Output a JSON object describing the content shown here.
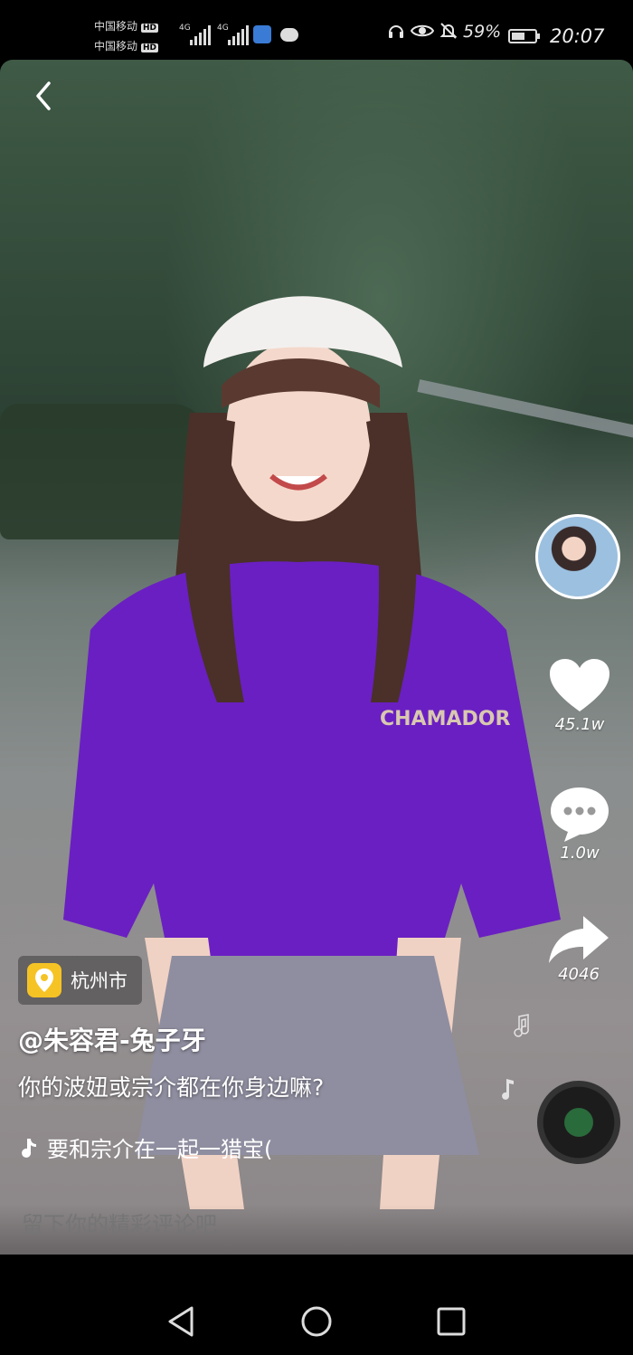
{
  "status_bar": {
    "carrier_1": "中国移动",
    "carrier_2": "中国移动",
    "hd_badge": "HD",
    "net_1": "4G",
    "net_2": "4G",
    "battery_percent": "59%",
    "battery_level": 0.59,
    "time": "20:07",
    "icons": [
      "headphones-icon",
      "eye-icon",
      "bell-off-icon",
      "battery-icon"
    ]
  },
  "video": {
    "back_icon": "chevron-left-icon",
    "like_count": "45.1w",
    "comment_count": "1.0w",
    "share_count": "4046",
    "location": "杭州市",
    "author": "@朱容君-兔子牙",
    "caption": "你的波妞或宗介都在你身边嘛?",
    "music": "要和宗介在一起一猎宝(",
    "comment_placeholder": "留下你的精彩评论吧",
    "shirt_text": "CHAMADOR"
  },
  "nav_bar": {
    "icons": [
      "back-triangle-icon",
      "home-circle-icon",
      "recents-square-icon"
    ]
  },
  "colors": {
    "location_badge": "#f6c325",
    "shirt": "#6a1fc2"
  }
}
